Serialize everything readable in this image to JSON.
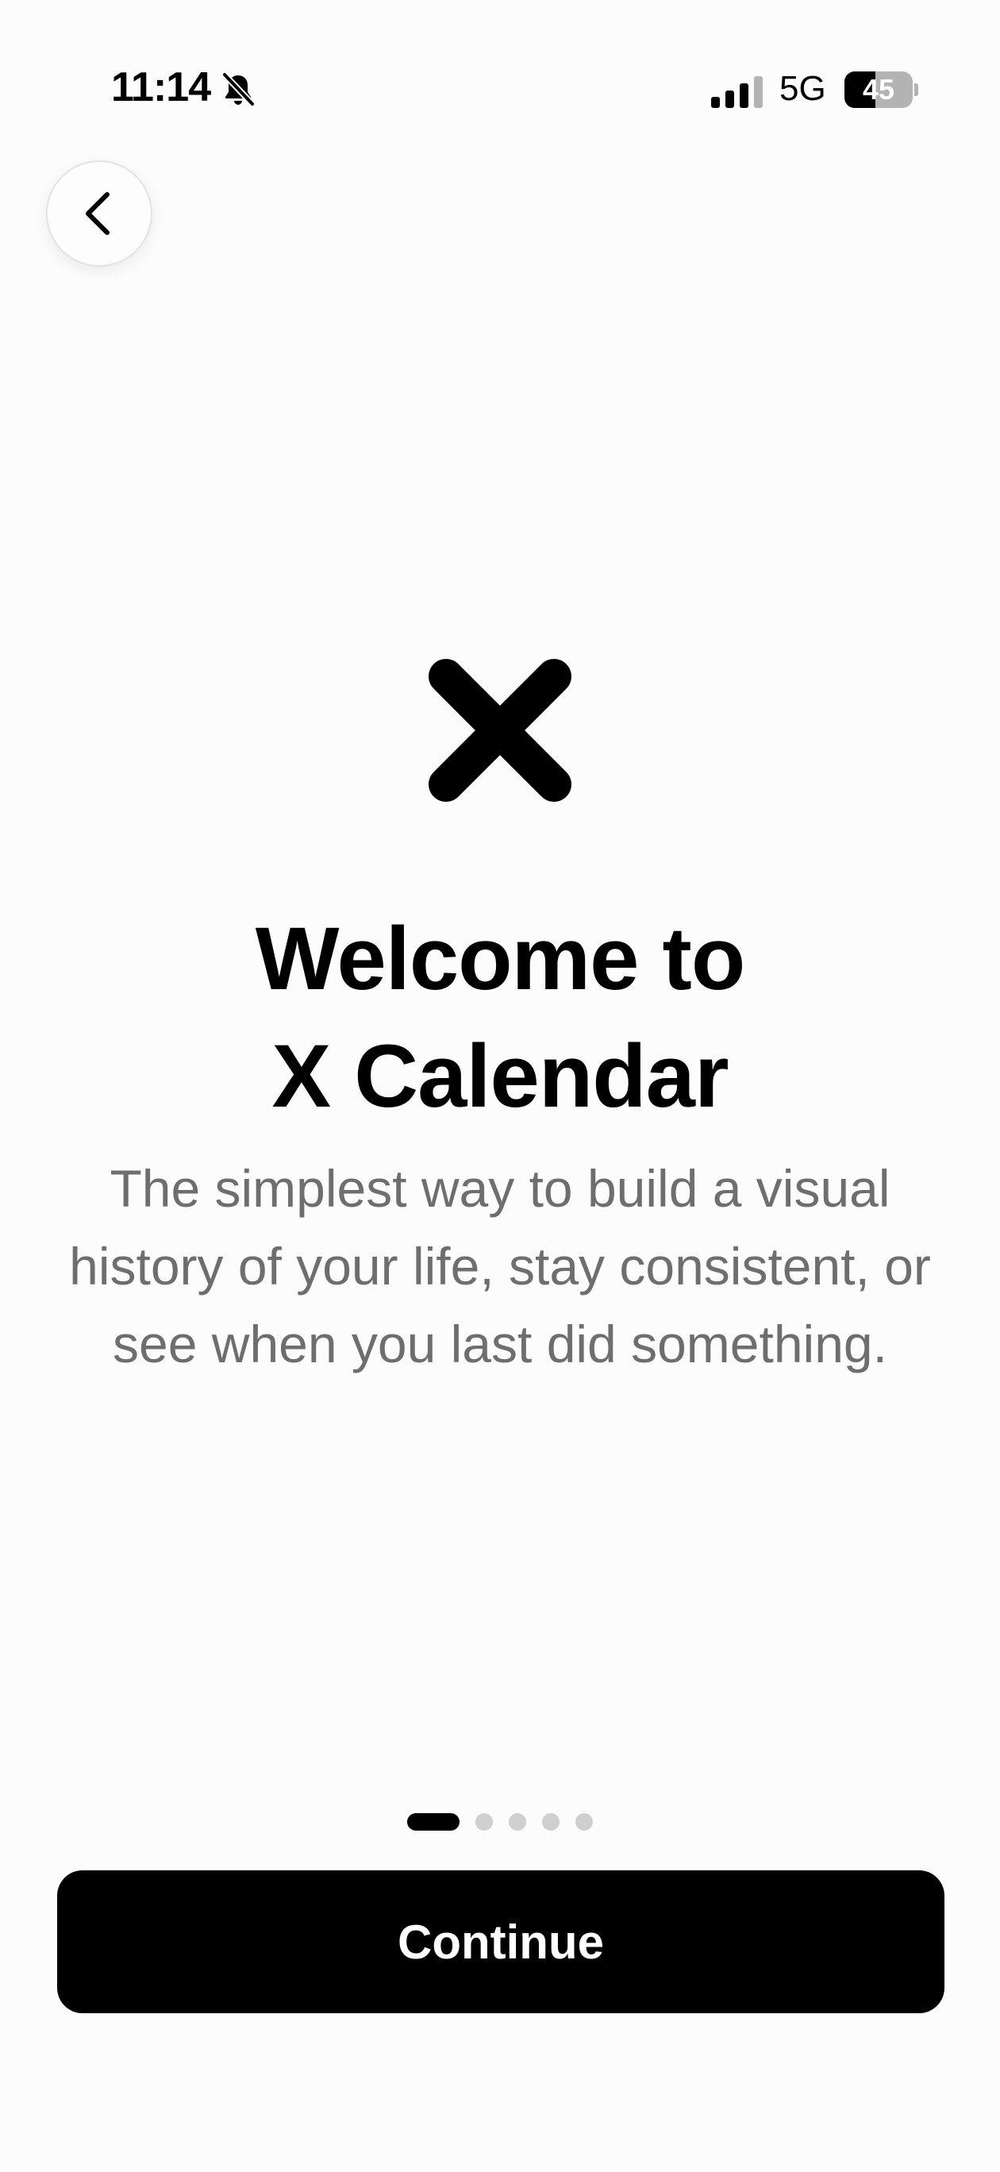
{
  "status_bar": {
    "time": "11:14",
    "silent_icon": "bell-slash-icon",
    "signal_icon": "cellular-signal-icon",
    "network": "5G",
    "battery_level": "45",
    "battery_fraction": 0.45
  },
  "navigation": {
    "back_icon": "chevron-left-icon"
  },
  "logo": {
    "icon": "x-mark-icon"
  },
  "welcome": {
    "title_line1": "Welcome to",
    "title_line2": "X Calendar",
    "description": "The simplest way to build a visual history of your life, stay consistent, or see when you last did something."
  },
  "page_indicator": {
    "total": 5,
    "current": 1
  },
  "actions": {
    "continue_label": "Continue"
  },
  "colors": {
    "background": "#fcfcfc",
    "primary": "#000000",
    "text_secondary": "#6e6e6e",
    "button_text": "#ffffff",
    "dot_inactive": "#cfcfcf"
  }
}
